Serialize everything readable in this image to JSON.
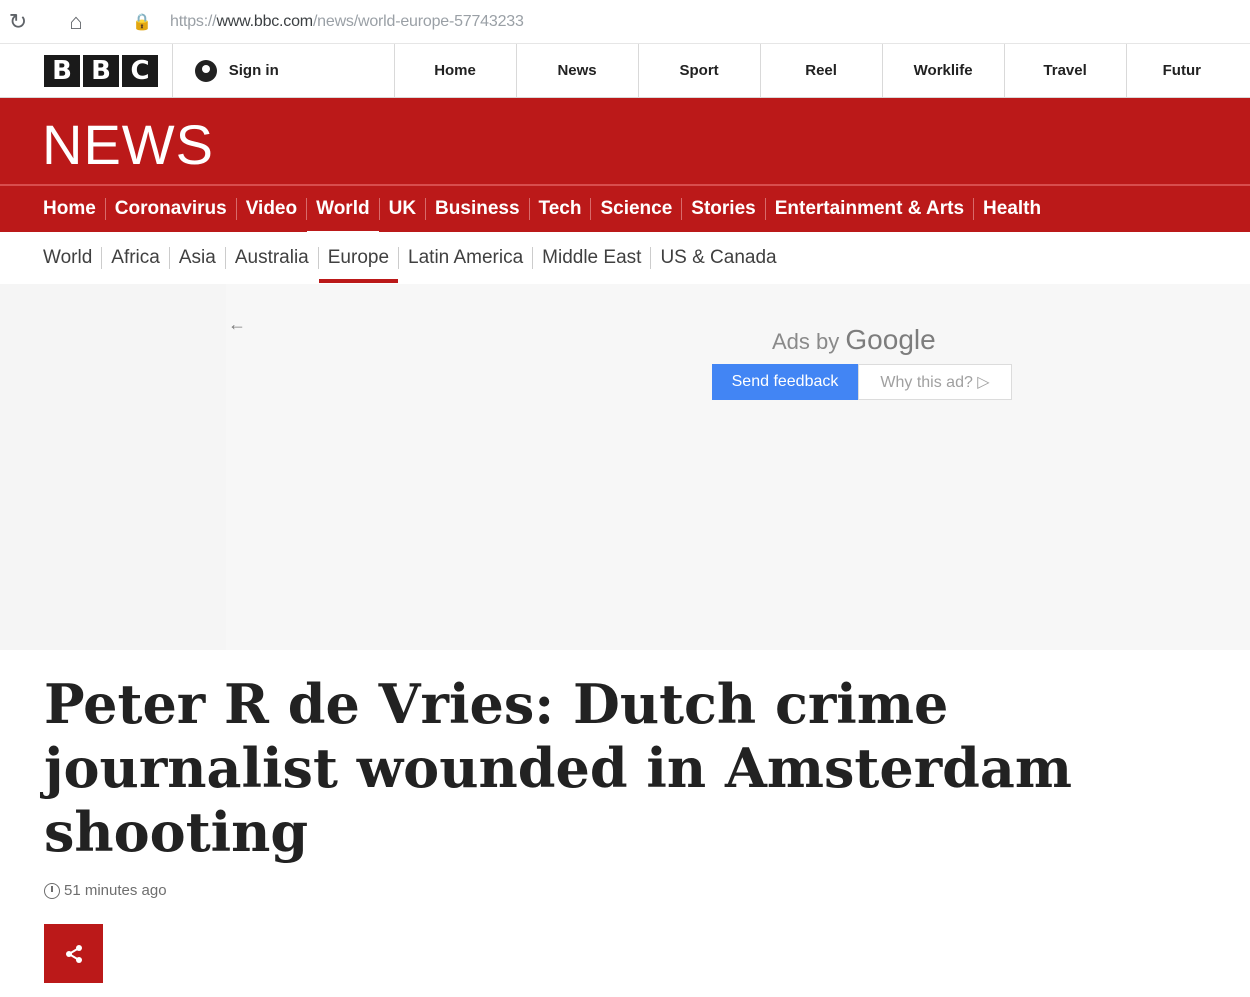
{
  "browser": {
    "url_prefix": "https://",
    "url_domain": "www.bbc.com",
    "url_path": "/news/world-europe-57743233"
  },
  "bbc_top": {
    "logo_letters": [
      "B",
      "B",
      "C"
    ],
    "sign_in": "Sign in",
    "links": [
      "Home",
      "News",
      "Sport",
      "Reel",
      "Worklife",
      "Travel",
      "Futur"
    ]
  },
  "banner": {
    "title": "NEWS"
  },
  "section_nav": {
    "items": [
      "Home",
      "Coronavirus",
      "Video",
      "World",
      "UK",
      "Business",
      "Tech",
      "Science",
      "Stories",
      "Entertainment & Arts",
      "Health"
    ],
    "active": "World"
  },
  "sub_nav": {
    "items": [
      "World",
      "Africa",
      "Asia",
      "Australia",
      "Europe",
      "Latin America",
      "Middle East",
      "US & Canada"
    ],
    "active": "Europe"
  },
  "ad": {
    "ads_by": "Ads by",
    "google": "Google",
    "send_feedback": "Send feedback",
    "why_this_ad": "Why this ad? ▷"
  },
  "article": {
    "headline": "Peter R de Vries: Dutch crime journalist wounded in Amsterdam shooting",
    "timestamp": "51 minutes ago"
  },
  "colors": {
    "bbc_red": "#bb1919",
    "google_blue": "#4285f4"
  }
}
